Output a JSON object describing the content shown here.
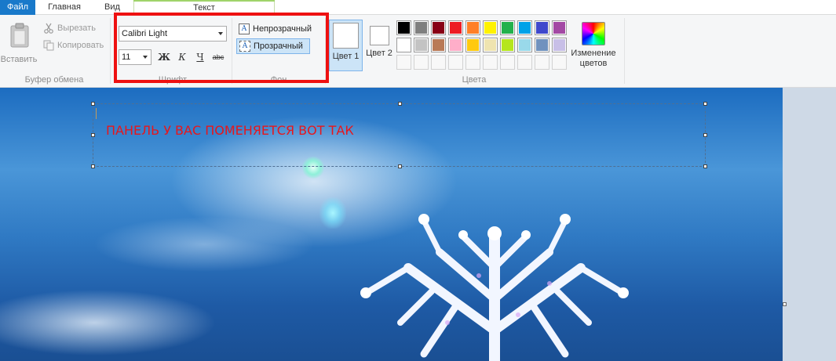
{
  "tabs": {
    "file": "Файл",
    "home": "Главная",
    "view": "Вид",
    "text": "Текст"
  },
  "clipboard": {
    "paste_label": "Вставить",
    "cut_label": "Вырезать",
    "copy_label": "Копировать",
    "group_label": "Буфер обмена"
  },
  "font": {
    "family_value": "Calibri Light",
    "size_value": "11",
    "bold_glyph": "Ж",
    "italic_glyph": "К",
    "underline_glyph": "Ч",
    "strikethrough_glyph": "abc",
    "group_label": "Шрифт"
  },
  "background": {
    "opaque_label": "Непрозрачный",
    "transparent_label": "Прозрачный",
    "selected": "transparent",
    "group_label": "Фон"
  },
  "colors": {
    "color1_label": "Цвет 1",
    "color2_label": "Цвет 2",
    "color1_value": "#ffffff",
    "color2_value": "#ffffff",
    "edit_colors_label": "Изменение цветов",
    "group_label": "Цвета",
    "palette_row1": [
      "#000000",
      "#7f7f7f",
      "#880015",
      "#ed1c24",
      "#ff7f27",
      "#fff200",
      "#22b14c",
      "#00a2e8",
      "#3f48cc",
      "#a349a4"
    ],
    "palette_row2": [
      "#ffffff",
      "#c3c3c3",
      "#b97a57",
      "#ffaec9",
      "#ffc90e",
      "#efe4b0",
      "#b5e61d",
      "#99d9ea",
      "#7092be",
      "#c8bfe7"
    ],
    "custom_slots": 10
  },
  "canvas": {
    "text_content": "ПАНЕЛЬ У ВАС ПОМЕНЯЕТСЯ ВОТ ТАК",
    "text_color": "#e8161b"
  },
  "accent_colors": {
    "file_tab": "#1979ca",
    "highlight_frame": "#ee1111",
    "text_tab_accent": "#9fd36a"
  }
}
